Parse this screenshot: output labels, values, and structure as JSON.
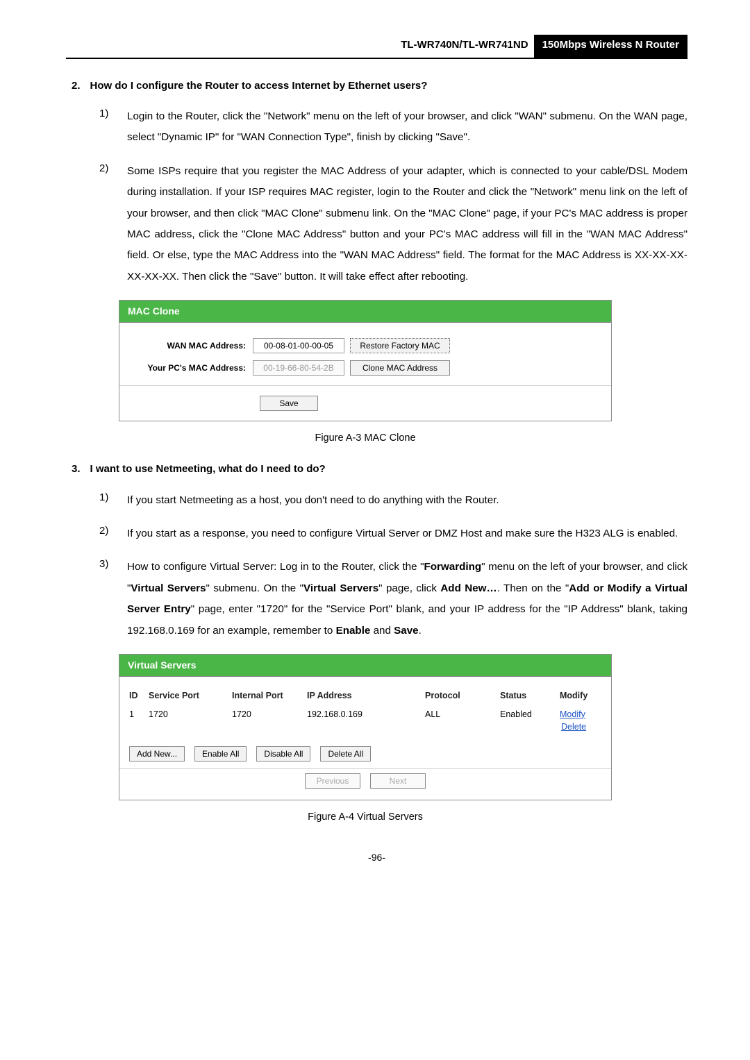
{
  "header": {
    "model": "TL-WR740N/TL-WR741ND",
    "desc": "150Mbps Wireless N Router"
  },
  "q2": {
    "num": "2.",
    "title": "How do I configure the Router to access Internet by Ethernet users?",
    "step1_num": "1)",
    "step1": "Login to the Router, click the \"Network\" menu on the left of your browser, and click \"WAN\" submenu. On the WAN page, select \"Dynamic IP\" for \"WAN Connection Type\", finish by clicking \"Save\".",
    "step2_num": "2)",
    "step2": "Some ISPs require that you register the MAC Address of your adapter, which is connected to your cable/DSL Modem during installation. If your ISP requires MAC register, login to the Router and click the \"Network\" menu link on the left of your browser, and then click \"MAC Clone\" submenu link. On the \"MAC Clone\" page, if your PC's MAC address is proper MAC address, click the \"Clone MAC Address\" button and your PC's MAC address will fill in the \"WAN MAC Address\" field. Or else, type the MAC Address into the \"WAN MAC Address\" field. The format for the MAC Address is XX-XX-XX-XX-XX-XX. Then click the \"Save\" button. It will take effect after rebooting."
  },
  "mac_clone": {
    "title": "MAC Clone",
    "wan_label": "WAN MAC Address:",
    "wan_value": "00-08-01-00-00-05",
    "restore_btn": "Restore Factory MAC",
    "pc_label": "Your PC's MAC Address:",
    "pc_value": "00-19-66-80-54-2B",
    "clone_btn": "Clone MAC Address",
    "save_btn": "Save",
    "caption": "Figure A-3    MAC Clone"
  },
  "q3": {
    "num": "3.",
    "title": "I want to use Netmeeting, what do I need to do?",
    "step1_num": "1)",
    "step1": "If you start Netmeeting as a host, you don't need to do anything with the Router.",
    "step2_num": "2)",
    "step2": "If you start as a response, you need to configure Virtual Server or DMZ Host and make sure the H323 ALG is enabled.",
    "step3_num": "3)",
    "step3_a": "How to configure Virtual Server: Log in to the Router, click the \"",
    "step3_b": "Forwarding",
    "step3_c": "\" menu on the left of your browser, and click \"",
    "step3_d": "Virtual Servers",
    "step3_e": "\" submenu. On the \"",
    "step3_f": "Virtual Servers",
    "step3_g": "\" page, click ",
    "step3_h": "Add New…",
    "step3_i": ". Then on the \"",
    "step3_j": "Add or Modify a Virtual Server Entry",
    "step3_k": "\" page, enter \"1720\" for the \"Service Port\" blank, and your IP address for the \"IP Address\" blank, taking 192.168.0.169 for an example, remember to ",
    "step3_l": "Enable",
    "step3_m": " and ",
    "step3_n": "Save",
    "step3_o": "."
  },
  "virtual_servers": {
    "title": "Virtual Servers",
    "headers": {
      "id": "ID",
      "service_port": "Service Port",
      "internal_port": "Internal Port",
      "ip": "IP Address",
      "protocol": "Protocol",
      "status": "Status",
      "modify": "Modify"
    },
    "row": {
      "id": "1",
      "service_port": "1720",
      "internal_port": "1720",
      "ip": "192.168.0.169",
      "protocol": "ALL",
      "status": "Enabled",
      "modify": "Modify",
      "delete": "Delete"
    },
    "btns": {
      "add": "Add New...",
      "enable": "Enable All",
      "disable": "Disable All",
      "delete": "Delete All",
      "prev": "Previous",
      "next": "Next"
    },
    "caption": "Figure A-4    Virtual Servers"
  },
  "page_num": "-96-"
}
